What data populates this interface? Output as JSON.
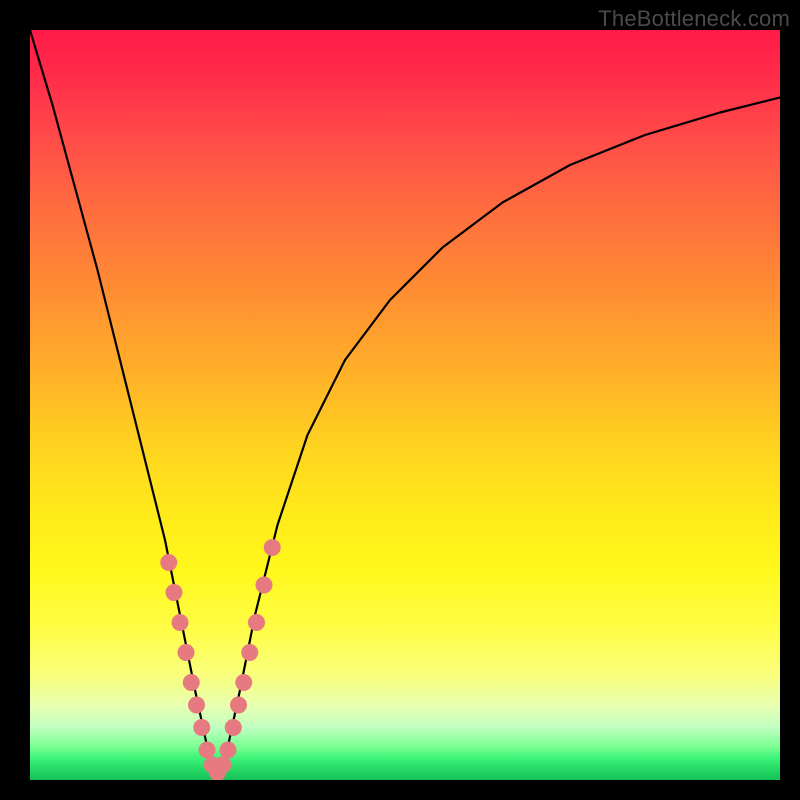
{
  "watermark": "TheBottleneck.com",
  "colors": {
    "background": "#000000",
    "curve": "#000000",
    "marker": "#e77a80",
    "gradient_top": "#ff1a47",
    "gradient_bottom": "#14c057"
  },
  "chart_data": {
    "type": "line",
    "title": "",
    "xlabel": "",
    "ylabel": "",
    "xlim": [
      0,
      100
    ],
    "ylim": [
      0,
      100
    ],
    "axes_hidden": true,
    "description": "Bottleneck-style V curve on a heatmap gradient: red (mismatch) at top, green (ideal) at bottom. Curve dips to the floor around x≈25 marking the balanced configuration; pink markers cluster near the trough.",
    "series": [
      {
        "name": "bottleneck-curve",
        "x": [
          0,
          3,
          6,
          9,
          12,
          15,
          18,
          20,
          22,
          23.5,
          25,
          26.5,
          28,
          30,
          33,
          37,
          42,
          48,
          55,
          63,
          72,
          82,
          92,
          100
        ],
        "y": [
          100,
          90,
          79,
          68,
          56,
          44,
          32,
          22,
          12,
          5,
          1,
          5,
          12,
          22,
          34,
          46,
          56,
          64,
          71,
          77,
          82,
          86,
          89,
          91
        ]
      }
    ],
    "markers": {
      "name": "highlighted-points",
      "color": "#e77a80",
      "x": [
        18.5,
        19.2,
        20.0,
        20.8,
        21.5,
        22.2,
        22.9,
        23.6,
        24.3,
        25.0,
        25.7,
        26.4,
        27.1,
        27.8,
        28.5,
        29.3,
        30.2,
        31.2,
        32.3
      ],
      "y": [
        29,
        25,
        21,
        17,
        13,
        10,
        7,
        4,
        2,
        1,
        2,
        4,
        7,
        10,
        13,
        17,
        21,
        26,
        31
      ]
    }
  }
}
